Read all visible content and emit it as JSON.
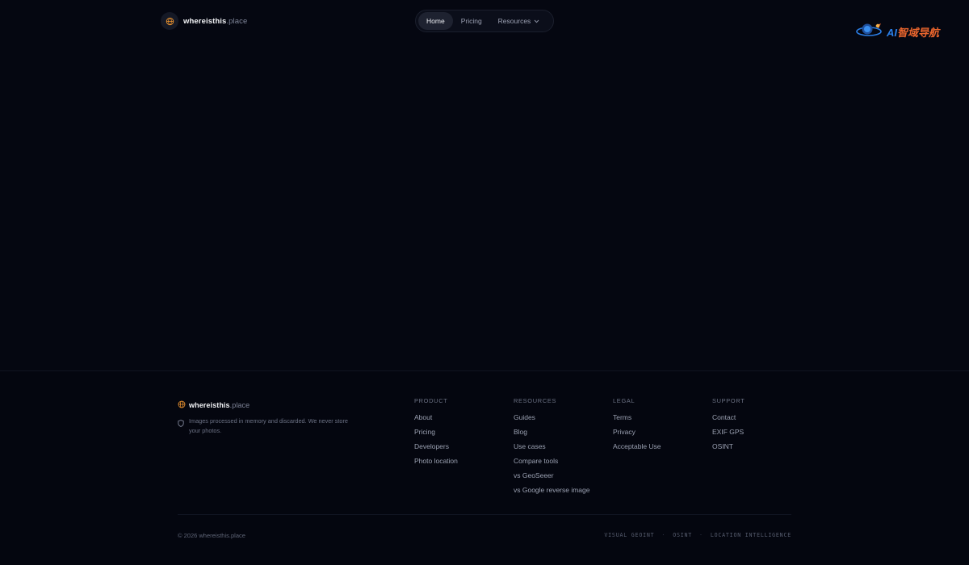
{
  "brand": {
    "name_bold": "whereisthis",
    "name_tld": ".place",
    "accent_color": "#e8912f"
  },
  "nav": {
    "items": [
      {
        "label": "Home",
        "active": true
      },
      {
        "label": "Pricing",
        "active": false
      },
      {
        "label": "Resources",
        "active": false,
        "icon": "chevron-down-icon"
      }
    ]
  },
  "ad_banner": {
    "ai": "AI",
    "text": "智域导航"
  },
  "footer": {
    "privacy_note": "Images processed in memory and discarded. We never store your photos.",
    "columns": [
      {
        "heading": "PRODUCT",
        "links": [
          "About",
          "Pricing",
          "Developers",
          "Photo location"
        ]
      },
      {
        "heading": "RESOURCES",
        "links": [
          "Guides",
          "Blog",
          "Use cases",
          "Compare tools",
          "vs GeoSeeer",
          "vs Google reverse image"
        ]
      },
      {
        "heading": "LEGAL",
        "links": [
          "Terms",
          "Privacy",
          "Acceptable Use"
        ]
      },
      {
        "heading": "SUPPORT",
        "links": [
          "Contact",
          "EXIF GPS",
          "OSINT"
        ]
      }
    ],
    "copyright": "© 2026 whereisthis.place",
    "tags": [
      "VISUAL GEOINT",
      "OSINT",
      "LOCATION INTELLIGENCE"
    ]
  }
}
